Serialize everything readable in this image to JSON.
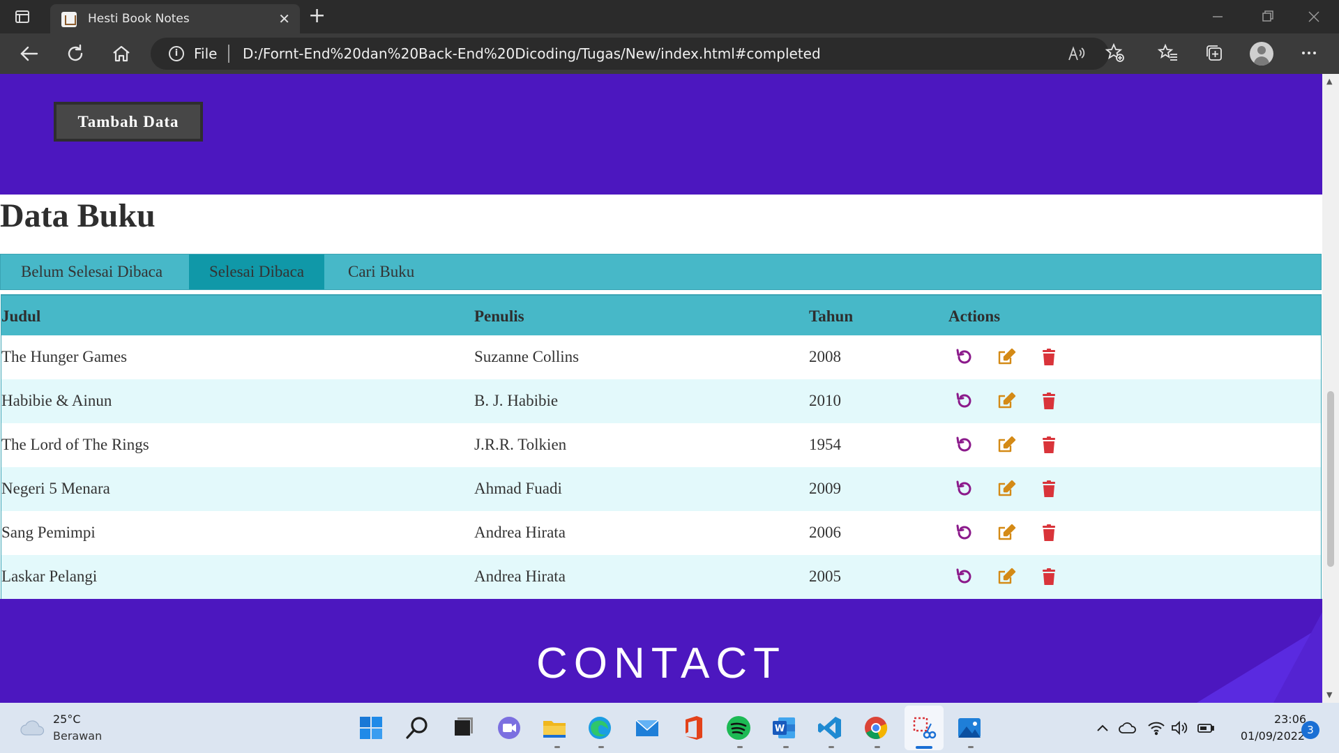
{
  "browser": {
    "tab_title": "Hesti Book Notes",
    "close_glyph": "✕",
    "new_tab_glyph": "+",
    "address_prefix": "File",
    "address_info_glyph": "i",
    "url": "D:/Fornt-End%20dan%20Back-End%20Dicoding/Tugas/New/index.html#completed"
  },
  "page": {
    "add_button": "Tambah Data",
    "section_title": "Data Buku",
    "tabs": [
      {
        "label": "Belum Selesai Dibaca",
        "active": false
      },
      {
        "label": "Selesai Dibaca",
        "active": true
      },
      {
        "label": "Cari Buku",
        "active": false
      }
    ],
    "table": {
      "headers": [
        "Judul",
        "Penulis",
        "Tahun",
        "Actions"
      ],
      "rows": [
        {
          "judul": "The Hunger Games",
          "penulis": "Suzanne Collins",
          "tahun": "2008"
        },
        {
          "judul": "Habibie & Ainun",
          "penulis": "B. J. Habibie",
          "tahun": "2010"
        },
        {
          "judul": "The Lord of The Rings",
          "penulis": "J.R.R. Tolkien",
          "tahun": "1954"
        },
        {
          "judul": "Negeri 5 Menara",
          "penulis": "Ahmad Fuadi",
          "tahun": "2009"
        },
        {
          "judul": "Sang Pemimpi",
          "penulis": "Andrea Hirata",
          "tahun": "2006"
        },
        {
          "judul": "Laskar Pelangi",
          "penulis": "Andrea Hirata",
          "tahun": "2005"
        }
      ],
      "action_icons": [
        "undo-icon",
        "edit-icon",
        "trash-icon"
      ]
    },
    "contact_title": "CONTACT"
  },
  "taskbar": {
    "weather_temp": "25°C",
    "weather_desc": "Berawan",
    "time": "23:06",
    "date": "01/09/2022",
    "notification_count": "3"
  },
  "colors": {
    "hero": "#4c17bf",
    "tab_bar": "#47b8c8",
    "tab_active": "#1098a8",
    "row_alt": "#e3f9fb",
    "undo_icon": "#8b1a8b",
    "edit_icon": "#d48a16",
    "trash_icon": "#d9343a"
  }
}
